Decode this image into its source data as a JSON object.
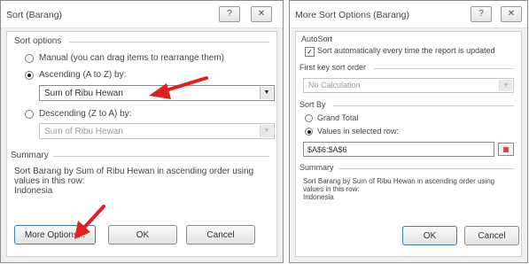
{
  "colors": {
    "arrow": "#e0201c",
    "dialog_bg": "#f0f0f0",
    "panel_bg": "#ffffff"
  },
  "dialog1": {
    "title": "Sort (Barang)",
    "help_glyph": "?",
    "close_glyph": "✕",
    "sort_options_label": "Sort options",
    "radio_manual": "Manual (you can drag items to rearrange them)",
    "radio_ascending": "Ascending (A to Z) by:",
    "ascending_value": "Sum of Ribu Hewan",
    "radio_descending": "Descending (Z to A) by:",
    "descending_value": "Sum of Ribu Hewan",
    "selected": "ascending",
    "summary_label": "Summary",
    "summary_text": [
      "Sort Barang by Sum of Ribu Hewan in ascending order using",
      "values in this row:",
      "Indonesia"
    ],
    "btn_more": "More Options...",
    "btn_ok": "OK",
    "btn_cancel": "Cancel"
  },
  "dialog2": {
    "title": "More Sort Options (Barang)",
    "help_glyph": "?",
    "close_glyph": "✕",
    "autosort_label": "AutoSort",
    "autosort_checkbox": "Sort automatically every time the report is updated",
    "autosort_checked": true,
    "first_key_label": "First key sort order",
    "first_key_value": "No Calculation",
    "sort_by_label": "Sort By",
    "radio_grand_total": "Grand Total",
    "radio_values_row": "Values in selected row:",
    "selected": "values-row",
    "row_ref": "$A$6:$A$6",
    "summary_label": "Summary",
    "summary_text": [
      "Sort Barang by Sum of Ribu Hewan in ascending order using",
      "values in this row:",
      "Indonesia"
    ],
    "btn_ok": "OK",
    "btn_cancel": "Cancel"
  }
}
